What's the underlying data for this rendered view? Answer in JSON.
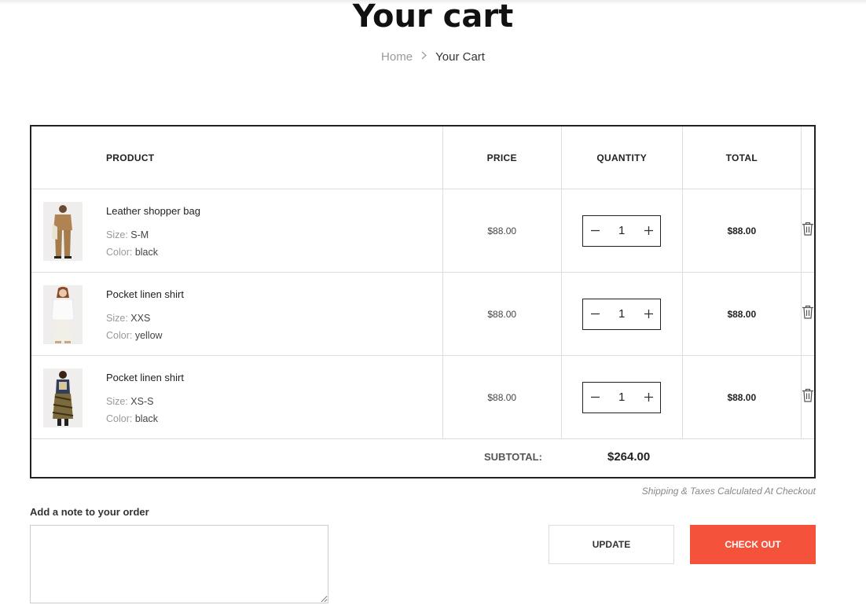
{
  "page": {
    "title": "Your cart",
    "breadcrumb": {
      "home": "Home",
      "current": "Your Cart"
    }
  },
  "table": {
    "headers": {
      "product": "PRODUCT",
      "price": "PRICE",
      "quantity": "QUANTITY",
      "total": "TOTAL"
    },
    "rows": [
      {
        "name": "Leather shopper bag",
        "size_label": "Size:",
        "size": "S-M",
        "color_label": "Color:",
        "color": "black",
        "price": "$88.00",
        "qty": "1",
        "total": "$88.00"
      },
      {
        "name": "Pocket linen shirt",
        "size_label": "Size:",
        "size": "XXS",
        "color_label": "Color:",
        "color": "yellow",
        "price": "$88.00",
        "qty": "1",
        "total": "$88.00"
      },
      {
        "name": "Pocket linen shirt",
        "size_label": "Size:",
        "size": "XS-S",
        "color_label": "Color:",
        "color": "black",
        "price": "$88.00",
        "qty": "1",
        "total": "$88.00"
      }
    ],
    "subtotal_label": "SUBTOTAL:",
    "subtotal": "$264.00"
  },
  "checkout": {
    "shipping_note": "Shipping & Taxes Calculated At Checkout",
    "note_label": "Add a note to your order",
    "update_label": "UPDATE",
    "checkout_label": "CHECK OUT"
  },
  "icons": {
    "breadcrumb_separator": "chevron-right-icon",
    "decrease": "minus-icon",
    "increase": "plus-icon",
    "remove": "trash-icon"
  },
  "colors": {
    "accent": "#f5523b",
    "border": "#222222"
  }
}
